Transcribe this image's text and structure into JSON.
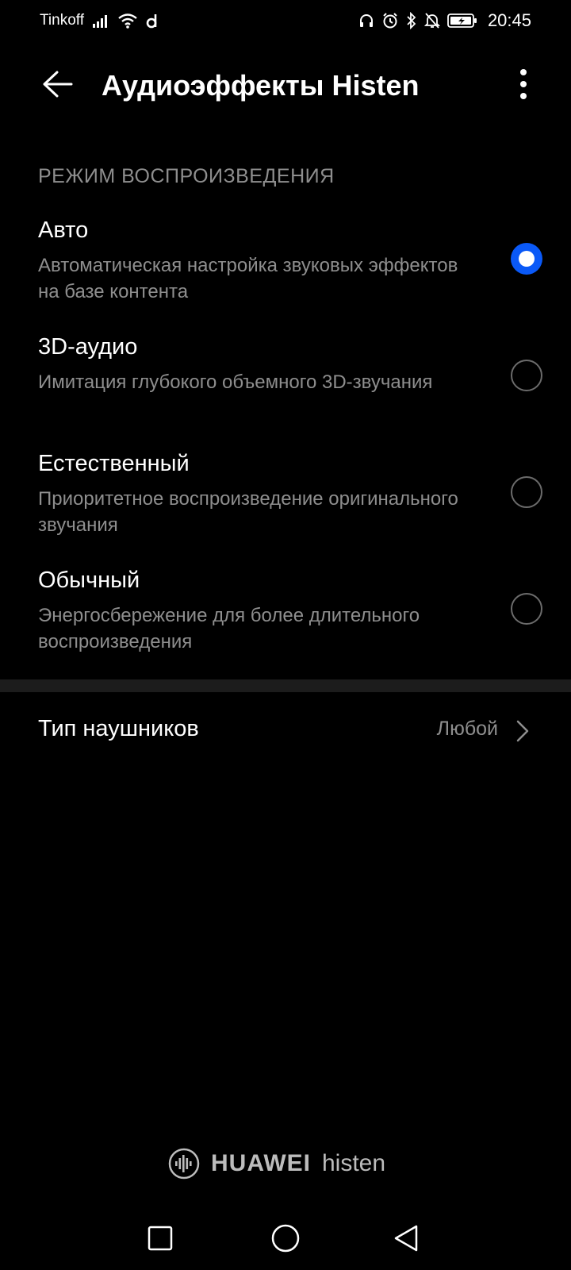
{
  "status_bar": {
    "carrier": "Tinkoff",
    "time": "20:45",
    "icons": [
      "signal-icon",
      "wifi-icon",
      "d-app-icon",
      "headphones-icon",
      "alarm-icon",
      "bluetooth-icon",
      "mute-icon",
      "battery-charging-icon"
    ]
  },
  "app_bar": {
    "title": "Аудиоэффекты Histen",
    "back_icon": "back-arrow-icon",
    "more_icon": "more-vertical-icon"
  },
  "section": {
    "header": "РЕЖИМ ВОСПРОИЗВЕДЕНИЯ"
  },
  "options": [
    {
      "title": "Авто",
      "description": "Автоматическая настройка звуковых эффектов на базе контента",
      "selected": true
    },
    {
      "title": "3D-аудио",
      "description": "Имитация глубокого объемного 3D-звучания",
      "selected": false
    },
    {
      "title": "Естественный",
      "description": "Приоритетное воспроизведение оригинального звучания",
      "selected": false
    },
    {
      "title": "Обычный",
      "description": "Энергосбережение для более длительного воспроизведения",
      "selected": false
    }
  ],
  "headphone_type": {
    "label": "Тип наушников",
    "value": "Любой"
  },
  "brand": {
    "name_bold": "HUAWEI",
    "name_light": "histen"
  },
  "colors": {
    "background": "#000000",
    "accent": "#0a59f7",
    "secondary_text": "#8e8e8e",
    "divider": "#1c1c1c"
  },
  "nav_bar": [
    "recents-square-icon",
    "home-circle-icon",
    "back-triangle-icon"
  ]
}
